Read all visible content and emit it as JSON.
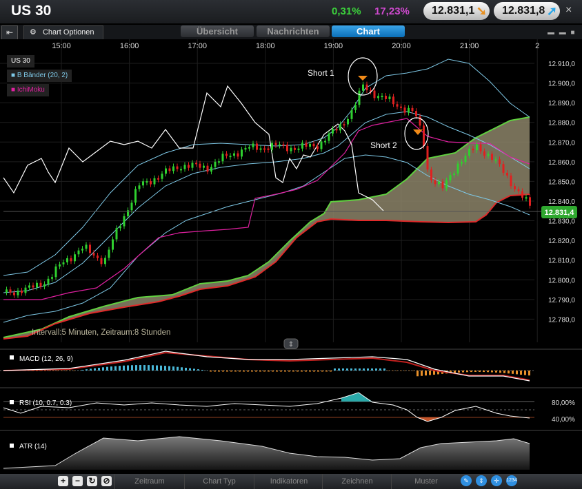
{
  "header": {
    "instrument": "US 30",
    "change_pct": "0,31%",
    "spread_pct": "17,23%",
    "sell_price": "12.831,1",
    "buy_price": "12.831,8",
    "close_symbol": "×"
  },
  "toolbar": {
    "chart_options": "Chart Optionen",
    "tabs": [
      "Übersicht",
      "Nachrichten",
      "Chart"
    ],
    "active_tab": "Chart"
  },
  "chart": {
    "time_labels": [
      "15:00",
      "16:00",
      "17:00",
      "18:00",
      "19:00",
      "20:00",
      "21:00",
      "2"
    ],
    "price_labels": [
      "12.910,0",
      "12.900,0",
      "12.890,0",
      "12.880,0",
      "12.870,0",
      "12.860,0",
      "12.850,0",
      "12.840,0",
      "12.830,0",
      "12.820,0",
      "12.810,0",
      "12.800,0",
      "12.790,0",
      "12.780,0"
    ],
    "current_price": "12.831,4",
    "legend": [
      "US 30",
      "B Bänder (20, 2)",
      "IchiMoku"
    ],
    "annotations": [
      "Short 1",
      "Short 2"
    ],
    "interval_text": "Intervall:5 Minuten, Zeitraum:8 Stunden",
    "colors": {
      "up": "#2fd02f",
      "down": "#e02020",
      "bollinger": "#7ec8e6",
      "ichimoku": "#e020a0",
      "cloud": "#8c8468",
      "accent": "#0b6fb8"
    }
  },
  "indicators": {
    "macd": "MACD (12, 26, 9)",
    "rsi": "RSI (10, 0.7, 0.3)",
    "rsi_levels": [
      "80,00%",
      "40,00%"
    ],
    "atr": "ATR (14)"
  },
  "bottom_menu": [
    "Zeitraum",
    "Chart Typ",
    "Indikatoren",
    "Zeichnen",
    "Muster"
  ],
  "bottom_icons": [
    "plus-icon",
    "minus-icon",
    "refresh-icon",
    "cancel-icon",
    "pencil-icon",
    "updown-icon",
    "crosshair-icon",
    "numbers-icon"
  ],
  "numbers_badge": "1234"
}
